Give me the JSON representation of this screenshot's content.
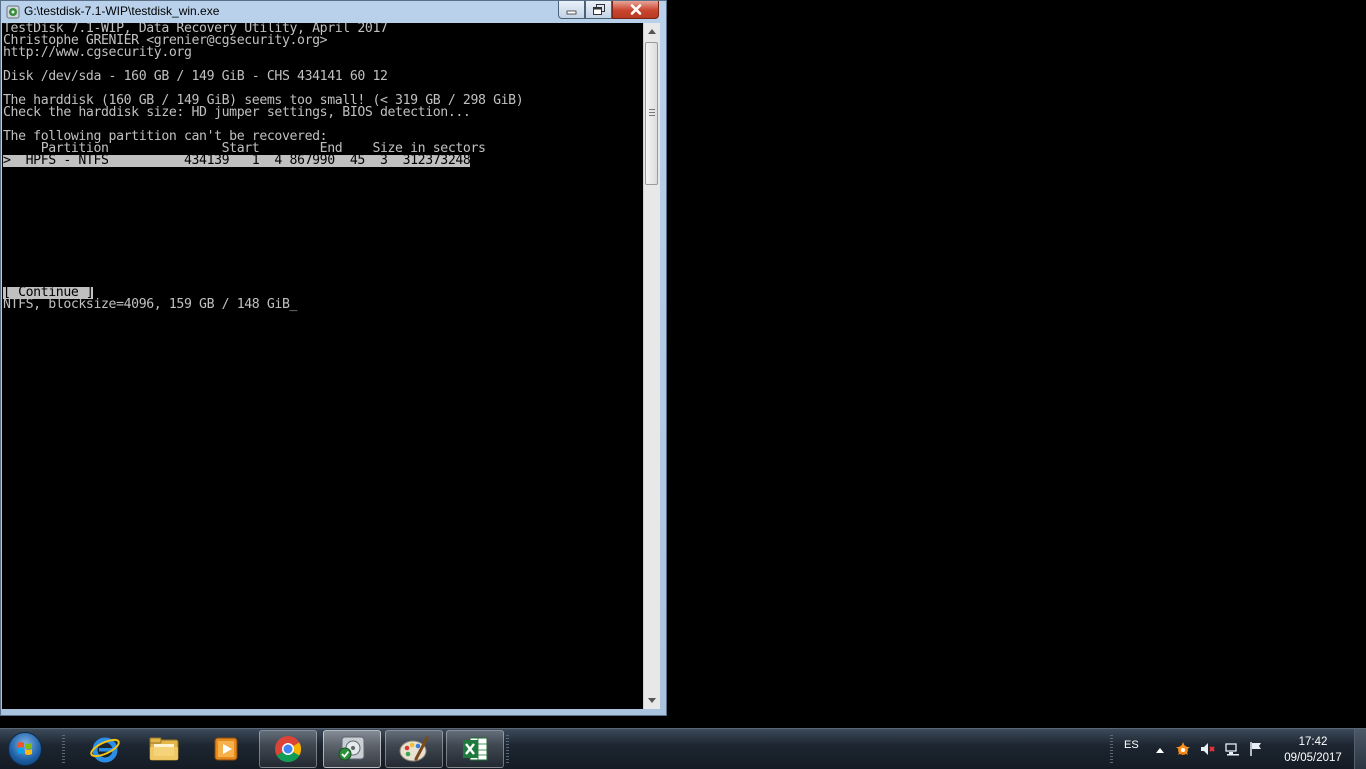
{
  "window": {
    "title": "G:\\testdisk-7.1-WIP\\testdisk_win.exe"
  },
  "console": {
    "lines": [
      "TestDisk 7.1-WIP, Data Recovery Utility, April 2017",
      "Christophe GRENIER <grenier@cgsecurity.org>",
      "http://www.cgsecurity.org",
      "",
      "Disk /dev/sda - 160 GB / 149 GiB - CHS 434141 60 12",
      "",
      "The harddisk (160 GB / 149 GiB) seems too small! (< 319 GB / 298 GiB)",
      "Check the harddisk size: HD jumper settings, BIOS detection...",
      "",
      "The following partition can't be recovered:",
      "     Partition               Start        End    Size in sectors"
    ],
    "partition_row": ">  HPFS - NTFS          434139   1  4 867990  45  3  312373248",
    "continue_label": "[ Continue ]",
    "status_line": "NTFS, blocksize=4096, 159 GB / 148 GiB",
    "cursor": "_"
  },
  "taskbar": {
    "items": [
      {
        "name": "internet-explorer",
        "icon": "ie-icon"
      },
      {
        "name": "windows-explorer",
        "icon": "folder-icon"
      },
      {
        "name": "media-player",
        "icon": "media-player-icon"
      },
      {
        "name": "chrome",
        "icon": "chrome-icon"
      },
      {
        "name": "testdisk",
        "icon": "testdisk-icon"
      },
      {
        "name": "paint",
        "icon": "paint-icon"
      },
      {
        "name": "excel",
        "icon": "excel-icon"
      }
    ],
    "tray": {
      "language": "ES",
      "time": "17:42",
      "date": "09/05/2017"
    }
  },
  "colors": {
    "console_bg": "#000000",
    "console_fg": "#c0c0c0",
    "selection_bg": "#c0c0c0"
  }
}
